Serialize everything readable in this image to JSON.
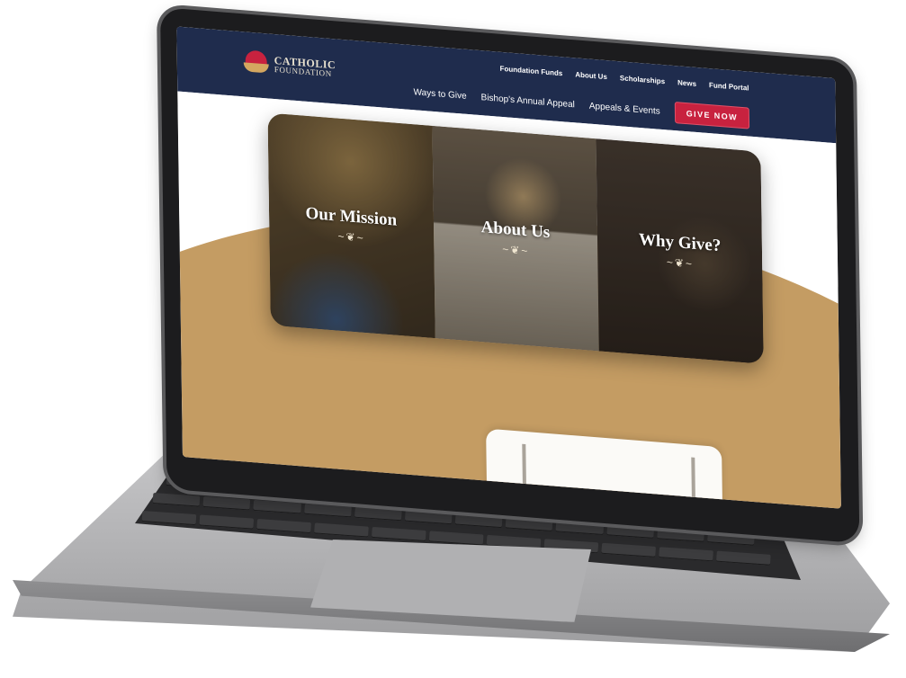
{
  "header": {
    "logo_line1": "CATHOLIC",
    "logo_line2": "FOUNDATION",
    "utility_nav": [
      "Foundation Funds",
      "About Us",
      "Scholarships",
      "News",
      "Fund Portal"
    ],
    "main_nav": [
      "Ways to Give",
      "Bishop's Annual Appeal",
      "Appeals & Events"
    ],
    "give_button": "GIVE NOW"
  },
  "hero": {
    "panels": [
      {
        "title": "Our Mission"
      },
      {
        "title": "About Us"
      },
      {
        "title": "Why Give?"
      }
    ],
    "flourish": "~❦~"
  },
  "colors": {
    "navy": "#1f2c4d",
    "accent_red": "#c8223f",
    "tan": "#c49c63"
  }
}
